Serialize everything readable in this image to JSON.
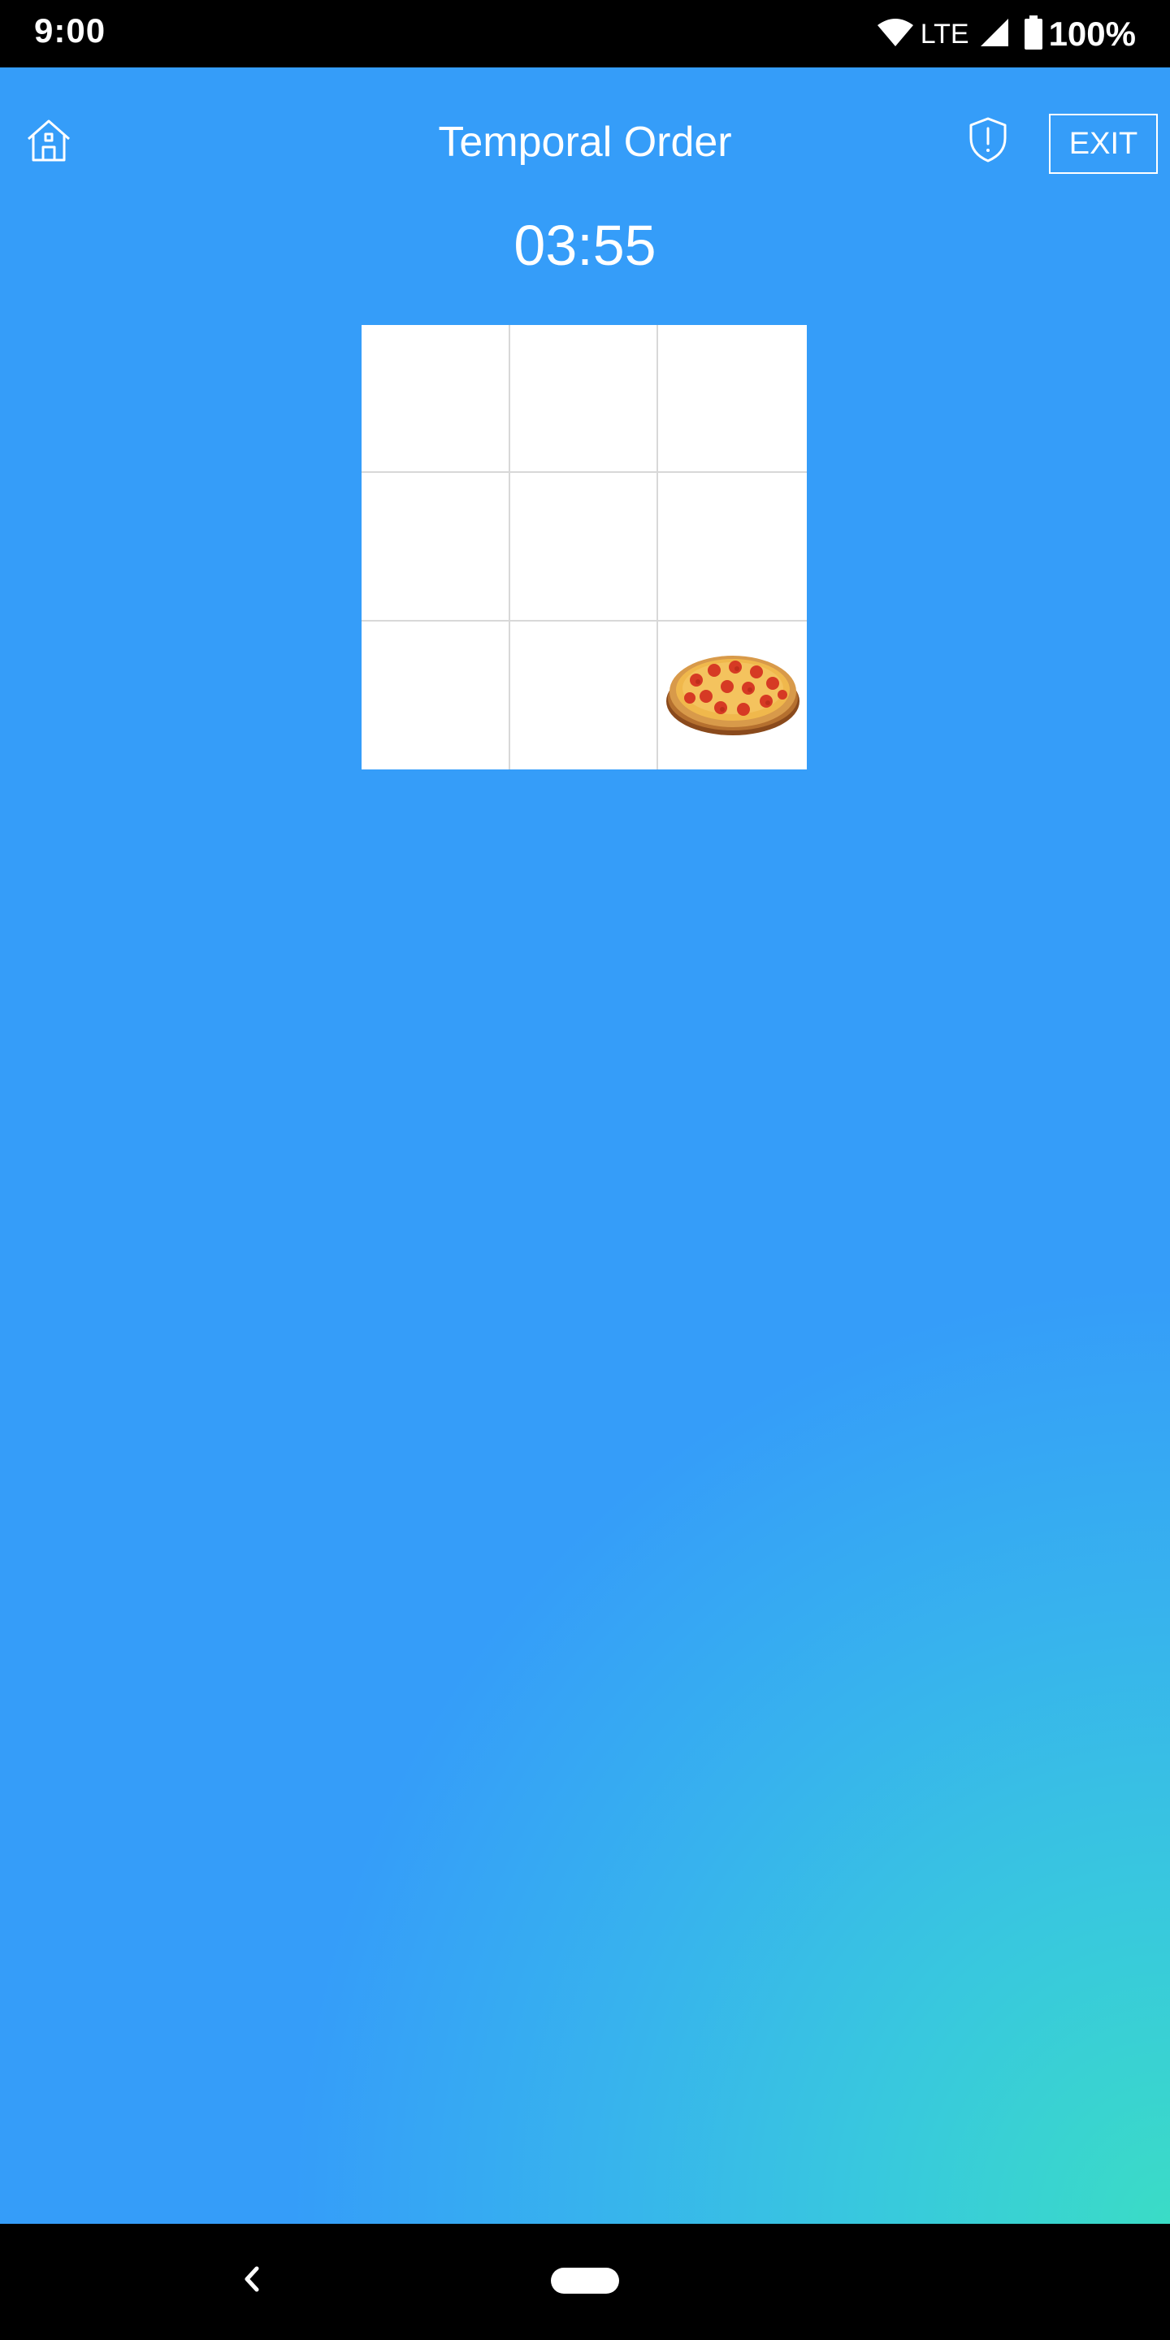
{
  "status_bar": {
    "time": "9:00",
    "network": "LTE",
    "battery": "100%",
    "icons": [
      "wifi-icon",
      "cell-signal-icon",
      "battery-icon"
    ]
  },
  "header": {
    "title": "Temporal Order",
    "exit_label": "EXIT",
    "home_icon": "home-icon",
    "shield_icon": "shield-alert-icon"
  },
  "timer": "03:55",
  "grid": {
    "rows": 3,
    "cols": 3,
    "cells": [
      {
        "content": ""
      },
      {
        "content": ""
      },
      {
        "content": ""
      },
      {
        "content": ""
      },
      {
        "content": ""
      },
      {
        "content": ""
      },
      {
        "content": ""
      },
      {
        "content": ""
      },
      {
        "content": "pizza-image"
      }
    ]
  },
  "nav_bar": {
    "back_icon": "back-chevron-icon",
    "home_pill": "home-pill-icon"
  },
  "colors": {
    "background_top": "#359df9",
    "background_bottom_right": "#3adcc6",
    "foreground": "#ffffff"
  }
}
